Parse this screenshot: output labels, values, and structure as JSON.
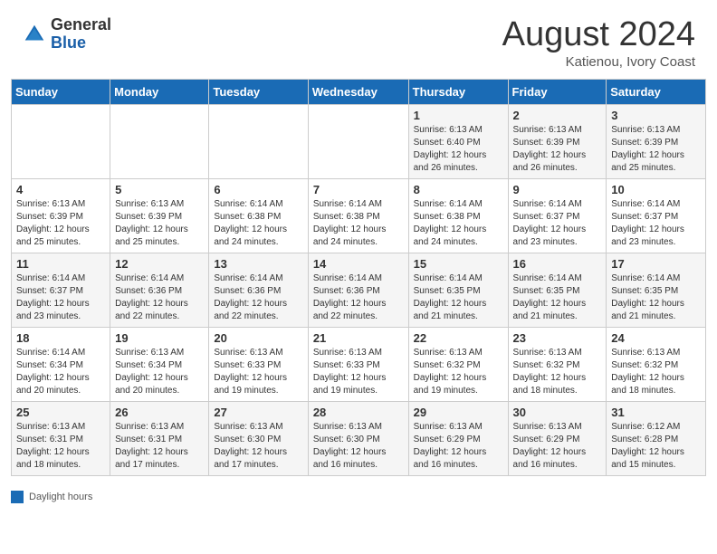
{
  "header": {
    "logo_general": "General",
    "logo_blue": "Blue",
    "month_title": "August 2024",
    "subtitle": "Katienou, Ivory Coast"
  },
  "days_of_week": [
    "Sunday",
    "Monday",
    "Tuesday",
    "Wednesday",
    "Thursday",
    "Friday",
    "Saturday"
  ],
  "legend": {
    "label": "Daylight hours"
  },
  "weeks": [
    [
      {
        "day": "",
        "info": ""
      },
      {
        "day": "",
        "info": ""
      },
      {
        "day": "",
        "info": ""
      },
      {
        "day": "",
        "info": ""
      },
      {
        "day": "1",
        "info": "Sunrise: 6:13 AM\nSunset: 6:40 PM\nDaylight: 12 hours\nand 26 minutes."
      },
      {
        "day": "2",
        "info": "Sunrise: 6:13 AM\nSunset: 6:39 PM\nDaylight: 12 hours\nand 26 minutes."
      },
      {
        "day": "3",
        "info": "Sunrise: 6:13 AM\nSunset: 6:39 PM\nDaylight: 12 hours\nand 25 minutes."
      }
    ],
    [
      {
        "day": "4",
        "info": "Sunrise: 6:13 AM\nSunset: 6:39 PM\nDaylight: 12 hours\nand 25 minutes."
      },
      {
        "day": "5",
        "info": "Sunrise: 6:13 AM\nSunset: 6:39 PM\nDaylight: 12 hours\nand 25 minutes."
      },
      {
        "day": "6",
        "info": "Sunrise: 6:14 AM\nSunset: 6:38 PM\nDaylight: 12 hours\nand 24 minutes."
      },
      {
        "day": "7",
        "info": "Sunrise: 6:14 AM\nSunset: 6:38 PM\nDaylight: 12 hours\nand 24 minutes."
      },
      {
        "day": "8",
        "info": "Sunrise: 6:14 AM\nSunset: 6:38 PM\nDaylight: 12 hours\nand 24 minutes."
      },
      {
        "day": "9",
        "info": "Sunrise: 6:14 AM\nSunset: 6:37 PM\nDaylight: 12 hours\nand 23 minutes."
      },
      {
        "day": "10",
        "info": "Sunrise: 6:14 AM\nSunset: 6:37 PM\nDaylight: 12 hours\nand 23 minutes."
      }
    ],
    [
      {
        "day": "11",
        "info": "Sunrise: 6:14 AM\nSunset: 6:37 PM\nDaylight: 12 hours\nand 23 minutes."
      },
      {
        "day": "12",
        "info": "Sunrise: 6:14 AM\nSunset: 6:36 PM\nDaylight: 12 hours\nand 22 minutes."
      },
      {
        "day": "13",
        "info": "Sunrise: 6:14 AM\nSunset: 6:36 PM\nDaylight: 12 hours\nand 22 minutes."
      },
      {
        "day": "14",
        "info": "Sunrise: 6:14 AM\nSunset: 6:36 PM\nDaylight: 12 hours\nand 22 minutes."
      },
      {
        "day": "15",
        "info": "Sunrise: 6:14 AM\nSunset: 6:35 PM\nDaylight: 12 hours\nand 21 minutes."
      },
      {
        "day": "16",
        "info": "Sunrise: 6:14 AM\nSunset: 6:35 PM\nDaylight: 12 hours\nand 21 minutes."
      },
      {
        "day": "17",
        "info": "Sunrise: 6:14 AM\nSunset: 6:35 PM\nDaylight: 12 hours\nand 21 minutes."
      }
    ],
    [
      {
        "day": "18",
        "info": "Sunrise: 6:14 AM\nSunset: 6:34 PM\nDaylight: 12 hours\nand 20 minutes."
      },
      {
        "day": "19",
        "info": "Sunrise: 6:13 AM\nSunset: 6:34 PM\nDaylight: 12 hours\nand 20 minutes."
      },
      {
        "day": "20",
        "info": "Sunrise: 6:13 AM\nSunset: 6:33 PM\nDaylight: 12 hours\nand 19 minutes."
      },
      {
        "day": "21",
        "info": "Sunrise: 6:13 AM\nSunset: 6:33 PM\nDaylight: 12 hours\nand 19 minutes."
      },
      {
        "day": "22",
        "info": "Sunrise: 6:13 AM\nSunset: 6:32 PM\nDaylight: 12 hours\nand 19 minutes."
      },
      {
        "day": "23",
        "info": "Sunrise: 6:13 AM\nSunset: 6:32 PM\nDaylight: 12 hours\nand 18 minutes."
      },
      {
        "day": "24",
        "info": "Sunrise: 6:13 AM\nSunset: 6:32 PM\nDaylight: 12 hours\nand 18 minutes."
      }
    ],
    [
      {
        "day": "25",
        "info": "Sunrise: 6:13 AM\nSunset: 6:31 PM\nDaylight: 12 hours\nand 18 minutes."
      },
      {
        "day": "26",
        "info": "Sunrise: 6:13 AM\nSunset: 6:31 PM\nDaylight: 12 hours\nand 17 minutes."
      },
      {
        "day": "27",
        "info": "Sunrise: 6:13 AM\nSunset: 6:30 PM\nDaylight: 12 hours\nand 17 minutes."
      },
      {
        "day": "28",
        "info": "Sunrise: 6:13 AM\nSunset: 6:30 PM\nDaylight: 12 hours\nand 16 minutes."
      },
      {
        "day": "29",
        "info": "Sunrise: 6:13 AM\nSunset: 6:29 PM\nDaylight: 12 hours\nand 16 minutes."
      },
      {
        "day": "30",
        "info": "Sunrise: 6:13 AM\nSunset: 6:29 PM\nDaylight: 12 hours\nand 16 minutes."
      },
      {
        "day": "31",
        "info": "Sunrise: 6:12 AM\nSunset: 6:28 PM\nDaylight: 12 hours\nand 15 minutes."
      }
    ]
  ]
}
